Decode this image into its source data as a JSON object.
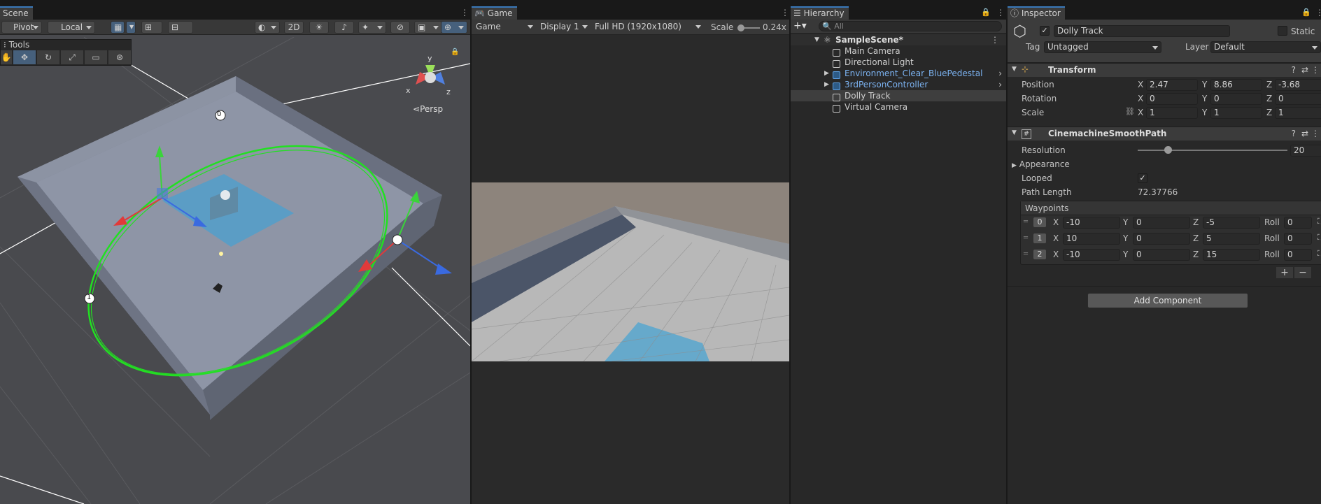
{
  "scene": {
    "tab": "Scene",
    "pivot": "Pivot",
    "local": "Local",
    "toggle_2d": "2D",
    "tools_label": "Tools",
    "persp": "Persp",
    "waypoint_labels": [
      "0",
      "1"
    ]
  },
  "game": {
    "tab": "Game",
    "mode": "Game",
    "display": "Display 1",
    "resolution": "Full HD (1920x1080)",
    "scale_label": "Scale",
    "scale_value": "0.24x"
  },
  "hierarchy": {
    "tab": "Hierarchy",
    "search_placeholder": "All",
    "scene_name": "SampleScene*",
    "items": [
      {
        "label": "Main Camera",
        "prefab": false,
        "expandable": false,
        "selected": false
      },
      {
        "label": "Directional Light",
        "prefab": false,
        "expandable": false,
        "selected": false
      },
      {
        "label": "Environment_Clear_BluePedestal",
        "prefab": true,
        "expandable": true,
        "selected": false
      },
      {
        "label": "3rdPersonController",
        "prefab": true,
        "expandable": true,
        "selected": false
      },
      {
        "label": "Dolly Track",
        "prefab": false,
        "expandable": false,
        "selected": true
      },
      {
        "label": "Virtual Camera",
        "prefab": false,
        "expandable": false,
        "selected": false
      }
    ]
  },
  "inspector": {
    "tab": "Inspector",
    "object_name": "Dolly Track",
    "static_label": "Static",
    "tag_label": "Tag",
    "tag_value": "Untagged",
    "layer_label": "Layer",
    "layer_value": "Default",
    "transform": {
      "title": "Transform",
      "position_label": "Position",
      "rotation_label": "Rotation",
      "scale_label": "Scale",
      "position": {
        "x": "2.47",
        "y": "8.86",
        "z": "-3.68"
      },
      "rotation": {
        "x": "0",
        "y": "0",
        "z": "0"
      },
      "scale": {
        "x": "1",
        "y": "1",
        "z": "1"
      }
    },
    "path": {
      "title": "CinemachineSmoothPath",
      "resolution_label": "Resolution",
      "resolution_value": "20",
      "resolution_fraction": 0.2,
      "appearance_label": "Appearance",
      "looped_label": "Looped",
      "path_length_label": "Path Length",
      "path_length_value": "72.37766",
      "waypoints_label": "Waypoints",
      "roll_label": "Roll",
      "waypoints": [
        {
          "index": "0",
          "x": "-10",
          "y": "0",
          "z": "-5",
          "roll": "0"
        },
        {
          "index": "1",
          "x": "10",
          "y": "0",
          "z": "5",
          "roll": "0"
        },
        {
          "index": "2",
          "x": "-10",
          "y": "0",
          "z": "15",
          "roll": "0"
        }
      ]
    },
    "add_component": "Add Component"
  },
  "axis_letters": {
    "x": "X",
    "y": "Y",
    "z": "Z"
  },
  "colors": {
    "accent": "#3a79bb",
    "prefab_text": "#7cb3f1",
    "selection": "#3e3e3e",
    "path_green": "#22e022"
  }
}
